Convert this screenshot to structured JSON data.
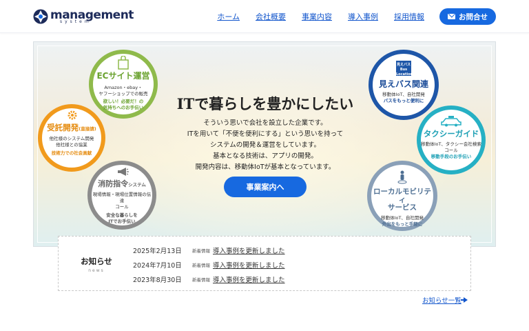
{
  "header": {
    "logo_main": "management",
    "logo_sub": "system",
    "nav": [
      {
        "label": "ホーム"
      },
      {
        "label": "会社概要"
      },
      {
        "label": "事業内容"
      },
      {
        "label": "導入事例"
      },
      {
        "label": "採用情報"
      }
    ],
    "contact_label": "お問合せ",
    "accent_color": "#1769e0"
  },
  "hero": {
    "title": "ITで暮らしを豊かにしたい",
    "lines": [
      "そういう思いで会社を設立した企業です。",
      "ITを用いて「不便を便利にする」という思いを持って",
      "システムの開発＆運営をしています。",
      "基本となる技術は、アプリの開発。",
      "開発内容は、移動体IoTが基本となっています。"
    ],
    "button_label": "事業案内へ",
    "services": {
      "ec": {
        "title": "ECサイト運営",
        "desc": [
          "Amazon・ebay・",
          "ヤフーショップでの販売"
        ],
        "highlight": [
          "欲しい！必要だ！の",
          "気持ちへのお手伝い"
        ],
        "color": "#8fba4b"
      },
      "jutaku": {
        "title": "受託開発",
        "title_sub": "(直接請)",
        "desc": [
          "他社様のシステム開発",
          "他社様との協業"
        ],
        "highlight": [
          "技術力での社会貢献"
        ],
        "color": "#f19a1c"
      },
      "shobo": {
        "title": "消防指令",
        "title_sub": "システム",
        "desc": [
          "現場情報・現場位置情報の伝達",
          "コール"
        ],
        "highlight": [
          "安全な暮らしを",
          "ITでお手伝い"
        ],
        "color": "#8c8c8c"
      },
      "bus": {
        "badge": [
          "見えバス",
          "Bus",
          "Location"
        ],
        "title": "見えバス関連",
        "desc": [
          "移動体IoT、自社開発"
        ],
        "highlight": [
          "バスをもっと便利に"
        ],
        "color": "#1e56a8"
      },
      "taxi": {
        "title": "タクシーガイド",
        "desc": [
          "移動体IoT、タクシー会社検索",
          "コール"
        ],
        "highlight": [
          "移動手段のお手伝い"
        ],
        "color": "#26b0c4"
      },
      "local": {
        "title": [
          "ローカルモビリティ",
          "サービス"
        ],
        "desc": [
          "移動体IoT、自社開発"
        ],
        "highlight": [
          "外出をもっと手軽に"
        ],
        "color": "#8aa0b8"
      }
    }
  },
  "news": {
    "label": "お知らせ",
    "label_en": "news",
    "items": [
      {
        "date": "2025年2月13日",
        "tag": "新着情報",
        "text": "導入事例を更新しました"
      },
      {
        "date": "2024年7月10日",
        "tag": "新着情報",
        "text": "導入事例を更新しました"
      },
      {
        "date": "2023年8月30日",
        "tag": "新着情報",
        "text": "導入事例を更新しました"
      }
    ],
    "more_label": "お知らせ一覧",
    "icons": {
      "more": "arrow-right-icon"
    }
  }
}
